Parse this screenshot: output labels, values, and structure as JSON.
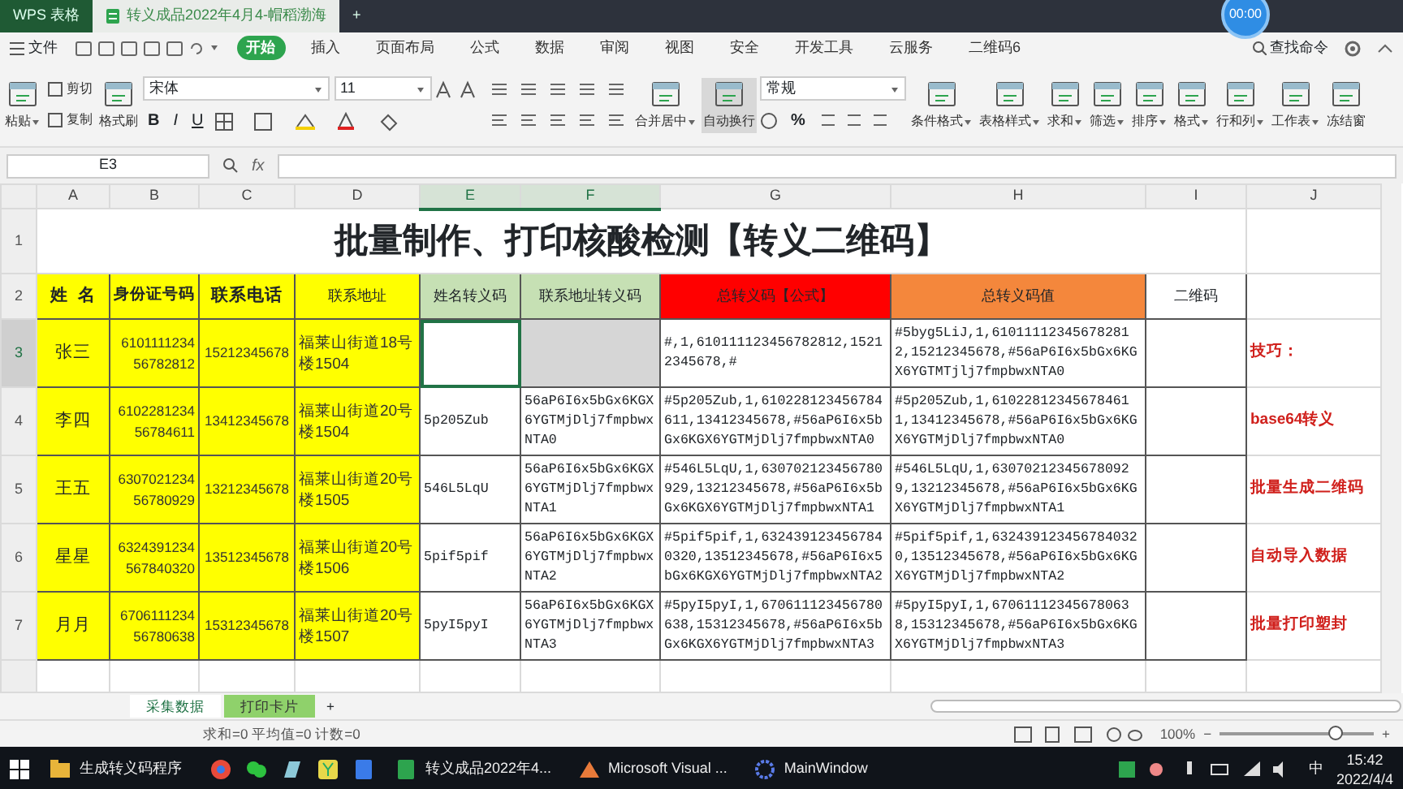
{
  "title_bar": {
    "tabs": [
      {
        "label": "WPS 表格",
        "kind": "app",
        "selected": false
      },
      {
        "label": "转义成品2022年4月4-帽稻渤海",
        "kind": "doc",
        "selected": true
      }
    ],
    "new_tab": "+",
    "recorder": "00:00"
  },
  "menu": {
    "file": "文件",
    "tabs": [
      {
        "label": "开始",
        "selected": true
      },
      {
        "label": "插入",
        "selected": false
      },
      {
        "label": "页面布局",
        "selected": false
      },
      {
        "label": "公式",
        "selected": false
      },
      {
        "label": "数据",
        "selected": false
      },
      {
        "label": "审阅",
        "selected": false
      },
      {
        "label": "视图",
        "selected": false
      },
      {
        "label": "安全",
        "selected": false
      },
      {
        "label": "开发工具",
        "selected": false
      },
      {
        "label": "云服务",
        "selected": false
      },
      {
        "label": "二维码6",
        "selected": false
      }
    ],
    "search": "查找命令"
  },
  "ribbon": [
    {
      "kind": "big",
      "label": "粘贴",
      "dropdown": true,
      "active": false
    },
    {
      "kind": "pair",
      "items": [
        "剪切",
        "复制"
      ]
    },
    {
      "kind": "big",
      "label": "格式刷",
      "dropdown": false,
      "active": false
    },
    {
      "kind": "font",
      "font": "宋体",
      "size": "11",
      "styles": [
        "B",
        "I",
        "U"
      ]
    },
    {
      "kind": "align"
    },
    {
      "kind": "big",
      "label": "合并居中",
      "dropdown": true,
      "active": false
    },
    {
      "kind": "big",
      "label": "自动换行",
      "dropdown": false,
      "active": true
    },
    {
      "kind": "number",
      "format": "常规",
      "symbol": "%"
    },
    {
      "kind": "big",
      "label": "条件格式",
      "dropdown": true,
      "active": false
    },
    {
      "kind": "big",
      "label": "表格样式",
      "dropdown": true,
      "active": false
    },
    {
      "kind": "big",
      "label": "求和",
      "dropdown": true,
      "active": false
    },
    {
      "kind": "big",
      "label": "筛选",
      "dropdown": true,
      "active": false
    },
    {
      "kind": "big",
      "label": "排序",
      "dropdown": true,
      "active": false
    },
    {
      "kind": "big",
      "label": "格式",
      "dropdown": true,
      "active": false
    },
    {
      "kind": "big",
      "label": "行和列",
      "dropdown": true,
      "active": false
    },
    {
      "kind": "big",
      "label": "工作表",
      "dropdown": true,
      "active": false
    },
    {
      "kind": "big",
      "label": "冻结窗",
      "dropdown": false,
      "active": false
    }
  ],
  "formula_bar": {
    "name_box": "E3",
    "fx": "fx"
  },
  "sheet": {
    "columns": [
      {
        "letter": "A",
        "selected": false
      },
      {
        "letter": "B",
        "selected": false
      },
      {
        "letter": "C",
        "selected": false
      },
      {
        "letter": "D",
        "selected": false
      },
      {
        "letter": "E",
        "selected": true
      },
      {
        "letter": "F",
        "selected": true
      },
      {
        "letter": "G",
        "selected": false
      },
      {
        "letter": "H",
        "selected": false
      },
      {
        "letter": "I",
        "selected": false
      },
      {
        "letter": "J",
        "selected": false
      }
    ],
    "title": {
      "number": "1",
      "text": "批量制作、打印核酸检测【转义二维码】"
    },
    "header": {
      "number": "2",
      "cells": [
        {
          "text": "姓  名",
          "color": "#ffff00"
        },
        {
          "text": "身份证号码",
          "color": "#ffff00"
        },
        {
          "text": "联系电话",
          "color": "#ffff00"
        },
        {
          "text": "联系地址",
          "color": "#ffff00"
        },
        {
          "text": "姓名转义码",
          "color": "#c6e0b4"
        },
        {
          "text": "联系地址转义码",
          "color": "#c6e0b4"
        },
        {
          "text": "总转义码【公式】",
          "color": "#ff0000"
        },
        {
          "text": "总转义码值",
          "color": "#f4873c"
        },
        {
          "text": "二维码",
          "color": "#ffffff"
        }
      ]
    },
    "rows": [
      {
        "number": "3",
        "selected": true,
        "name": "张三",
        "id_number": "610111123456782812",
        "phone": "15212345678",
        "address": "福莱山街道18号楼1504",
        "formula": "#,1,610111123456782812,15212345678,#",
        "code_value": "#5byg5LiJ,1,610111123456782812,15212345678,#56aP6I6x5bGx6KGX6YGTMTjlj7fmpbwxNTA0",
        "tip": "技巧："
      },
      {
        "number": "4",
        "selected": false,
        "name": "李四",
        "id_number": "610228123456784611",
        "phone": "13412345678",
        "address": "福莱山街道20号楼1504",
        "name_code": "5p205Zub",
        "address_code": "56aP6I6x5bGx6KGX6YGTMjDlj7fmpbwxNTA0",
        "formula": "#5p205Zub,1,610228123456784611,13412345678,#56aP6I6x5bGx6KGX6YGTMjDlj7fmpbwxNTA0",
        "code_value": "#5p205Zub,1,610228123456784611,13412345678,#56aP6I6x5bGx6KGX6YGTMjDlj7fmpbwxNTA0",
        "tip": "base64转义"
      },
      {
        "number": "5",
        "selected": false,
        "name": "王五",
        "id_number": "630702123456780929",
        "phone": "13212345678",
        "address": "福莱山街道20号楼1505",
        "name_code": "546L5LqU",
        "address_code": "56aP6I6x5bGx6KGX6YGTMjDlj7fmpbwxNTA1",
        "formula": "#546L5LqU,1,630702123456780929,13212345678,#56aP6I6x5bGx6KGX6YGTMjDlj7fmpbwxNTA1",
        "code_value": "#546L5LqU,1,630702123456780929,13212345678,#56aP6I6x5bGx6KGX6YGTMjDlj7fmpbwxNTA1",
        "tip": "批量生成二维码"
      },
      {
        "number": "6",
        "selected": false,
        "name": "星星",
        "id_number": "632439123456784032​0",
        "phone": "13512345678",
        "address": "福莱山街道20号楼1506",
        "name_code": "5pif5pif",
        "address_code": "56aP6I6x5bGx6KGX6YGTMjDlj7fmpbwxNTA2",
        "formula": "#5pif5pif,1,6324391234567840320,13512345678,#56aP6I6x5bGx6KGX6YGTMjDlj7fmpbwxNTA2",
        "code_value": "#5pif5pif,1,6324391234567840320,13512345678,#56aP6I6x5bGx6KGX6YGTMjDlj7fmpbwxNTA2",
        "tip": "自动导入数据"
      },
      {
        "number": "7",
        "selected": false,
        "name": "月月",
        "id_number": "670611123456780638",
        "phone": "15312345678",
        "address": "福莱山街道20号楼1507",
        "name_code": "5pyI5pyI",
        "address_code": "56aP6I6x5bGx6KGX6YGTMjDlj7fmpbwxNTA3",
        "formula": "#5pyI5pyI,1,670611123456780638,15312345678,#56aP6I6x5bGx6KGX6YGTMjDlj7fmpbwxNTA3",
        "code_value": "#5pyI5pyI,1,670611123456780638,15312345678,#56aP6I6x5bGx6KGX6YGTMjDlj7fmpbwxNTA3",
        "tip": "批量打印塑封"
      }
    ]
  },
  "sheet_tabs": [
    {
      "label": "采集数据",
      "selected": true
    },
    {
      "label": "打印卡片",
      "selected": false
    }
  ],
  "add_sheet": "+",
  "status_bar": {
    "stats": "求和=0  平均值=0  计数=0",
    "zoom": "100%",
    "minus": "−",
    "plus": "+",
    "level": 0.75
  },
  "taskbar": {
    "apps": [
      {
        "label": "生成转义码程序",
        "kind": "folder"
      },
      {
        "kind": "browser"
      },
      {
        "kind": "chat"
      },
      {
        "kind": "notes"
      },
      {
        "kind": "yellow"
      },
      {
        "kind": "word"
      },
      {
        "label": "转义成品2022年4...",
        "kind": "sheet"
      },
      {
        "label": "Microsoft Visual ...",
        "kind": "studio"
      },
      {
        "label": "MainWindow",
        "kind": "gear"
      }
    ],
    "ime": "中",
    "time": "15:42",
    "date": "2022/4/4"
  }
}
